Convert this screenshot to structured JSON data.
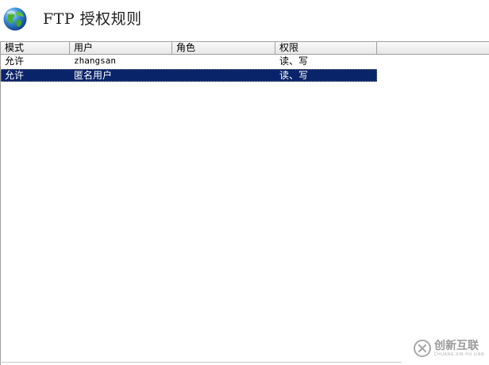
{
  "header": {
    "title": "FTP 授权规则",
    "icon": "globe-icon"
  },
  "table": {
    "columns": [
      "模式",
      "用户",
      "角色",
      "权限"
    ],
    "rows": [
      {
        "mode": "允许",
        "user": "zhangsan",
        "role": "",
        "permission": "读、写",
        "selected": false
      },
      {
        "mode": "允许",
        "user": "匿名用户",
        "role": "",
        "permission": "读、写",
        "selected": true
      }
    ],
    "selection_color": "#0a246a"
  },
  "watermark": {
    "text": "创新互联",
    "subtext": "CHUANG XIN HU LIAN",
    "icon": "brand-logo-icon"
  }
}
